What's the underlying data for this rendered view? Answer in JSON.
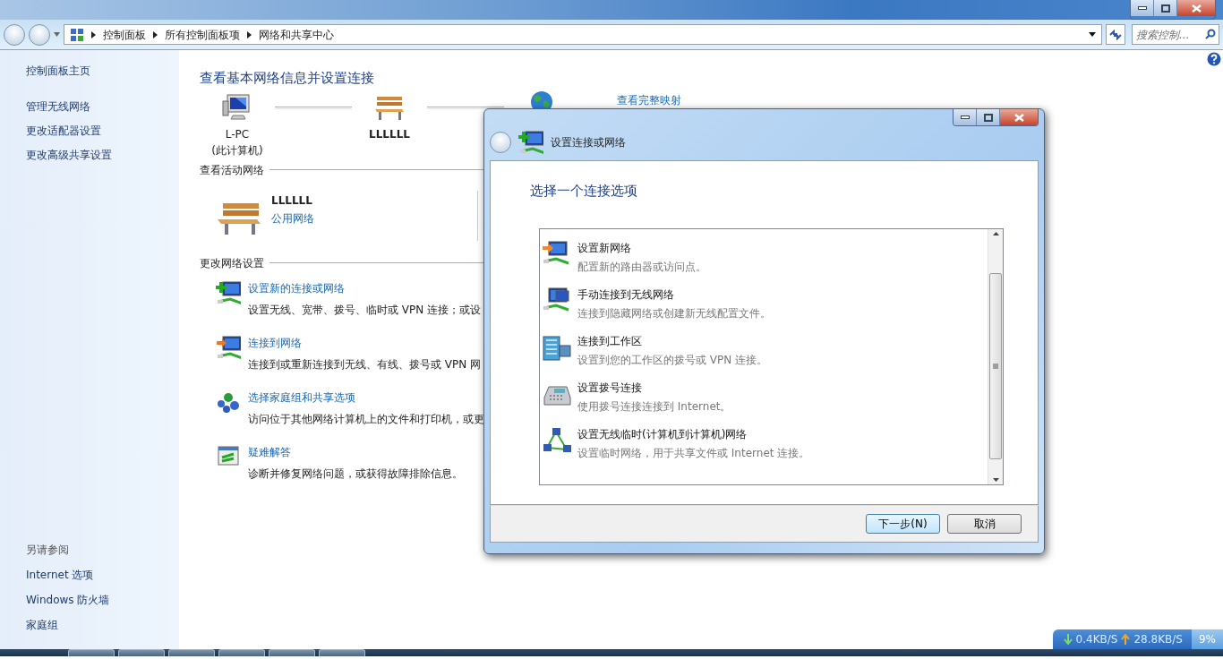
{
  "breadcrumb": [
    "控制面板",
    "所有控制面板项",
    "网络和共享中心"
  ],
  "search": {
    "placeholder": "搜索控制..."
  },
  "sidebar": {
    "home": "控制面板主页",
    "tasks": [
      "管理无线网络",
      "更改适配器设置",
      "更改高级共享设置"
    ],
    "see_also": {
      "title": "另请参阅",
      "links": [
        "Internet 选项",
        "Windows 防火墙",
        "家庭组"
      ]
    }
  },
  "content": {
    "title": "查看基本网络信息并设置连接",
    "map": {
      "nodes": [
        {
          "kind": "computer",
          "name": "L-PC",
          "sub": "(此计算机)"
        },
        {
          "kind": "bench",
          "name": "LLLLLL"
        },
        {
          "kind": "globe"
        }
      ],
      "link": "查看完整映射"
    },
    "active_networks": {
      "heading": "查看活动网络",
      "name": "LLLLLL",
      "type": "公用网络"
    },
    "change_settings": {
      "heading": "更改网络设置",
      "items": [
        {
          "kind": "new",
          "title": "设置新的连接或网络",
          "desc": "设置无线、宽带、拨号、临时或 VPN 连接；或设"
        },
        {
          "kind": "connect",
          "title": "连接到网络",
          "desc": "连接到或重新连接到无线、有线、拨号或 VPN 网"
        },
        {
          "kind": "homegroup",
          "title": "选择家庭组和共享选项",
          "desc": "访问位于其他网络计算机上的文件和打印机，或更"
        },
        {
          "kind": "troubleshoot",
          "title": "疑难解答",
          "desc": "诊断并修复网络问题，或获得故障排除信息。"
        }
      ]
    }
  },
  "dialog": {
    "title": "设置连接或网络",
    "heading": "选择一个连接选项",
    "options": [
      {
        "kind": "router",
        "title": "设置新网络",
        "desc": "配置新的路由器或访问点。"
      },
      {
        "kind": "wireless",
        "title": "手动连接到无线网络",
        "desc": "连接到隐藏网络或创建新无线配置文件。"
      },
      {
        "kind": "workplace",
        "title": "连接到工作区",
        "desc": "设置到您的工作区的拨号或 VPN 连接。"
      },
      {
        "kind": "dialup",
        "title": "设置拨号连接",
        "desc": "使用拨号连接连接到 Internet。"
      },
      {
        "kind": "adhoc",
        "title": "设置无线临时(计算机到计算机)网络",
        "desc": "设置临时网络，用于共享文件或 Internet 连接。"
      }
    ],
    "buttons": [
      {
        "label": "下一步(N)",
        "default": true
      },
      {
        "label": "取消",
        "default": false
      }
    ]
  },
  "speed_meter": {
    "download": "0.4KB/S",
    "upload": "28.8KB/S",
    "cpu": "9%"
  }
}
